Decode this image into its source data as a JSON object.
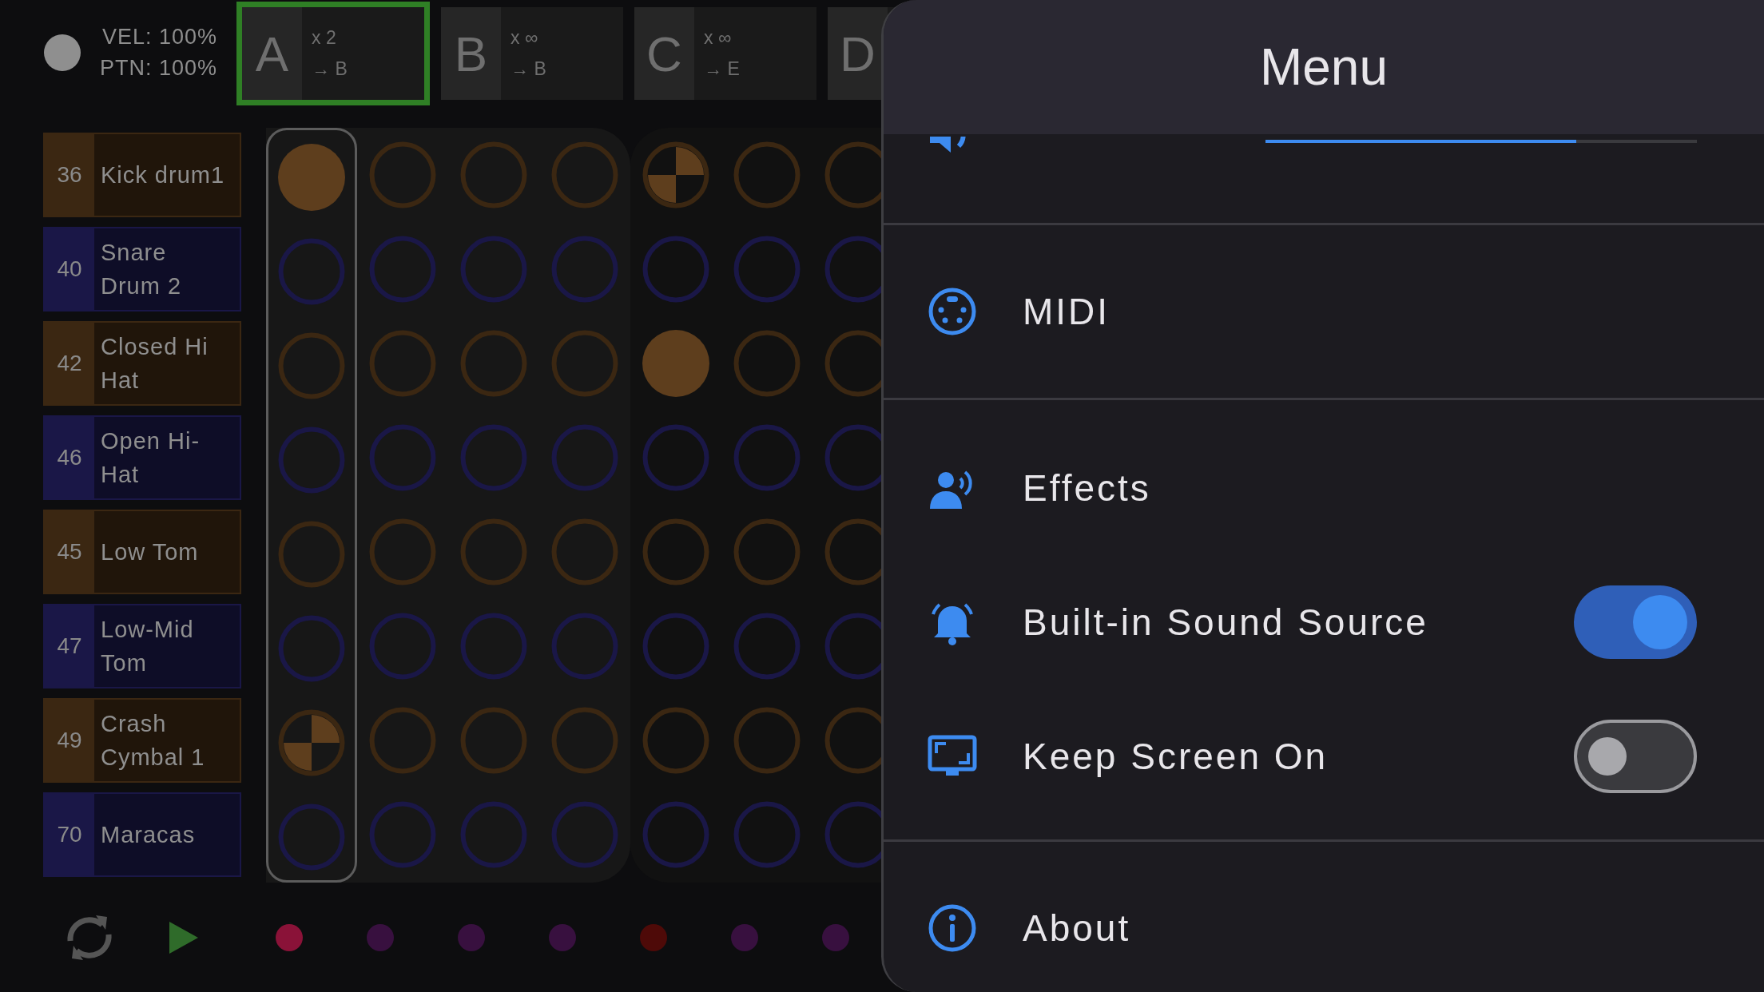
{
  "status": {
    "velocity": "VEL: 100%",
    "pattern": "PTN: 100%"
  },
  "patterns": [
    {
      "letter": "A",
      "repeat": "x 2",
      "next": "→ B",
      "selected": true
    },
    {
      "letter": "B",
      "repeat": "x ∞",
      "next": "→ B",
      "selected": false
    },
    {
      "letter": "C",
      "repeat": "x ∞",
      "next": "→ E",
      "selected": false
    },
    {
      "letter": "D",
      "selected": false
    }
  ],
  "tracks": [
    {
      "note": "36",
      "name": "Kick drum1",
      "color": "#3b2712",
      "steps": [
        {
          "kind": "on"
        },
        {
          "kind": "off"
        },
        {
          "kind": "off"
        },
        {
          "kind": "off"
        },
        {
          "kind": "half"
        },
        {
          "kind": "off"
        },
        {
          "kind": "off"
        }
      ]
    },
    {
      "note": "40",
      "name": "Snare Drum 2",
      "color": "#1a1747",
      "steps": [
        {
          "kind": "off"
        },
        {
          "kind": "off"
        },
        {
          "kind": "off"
        },
        {
          "kind": "off"
        },
        {
          "kind": "off"
        },
        {
          "kind": "off"
        },
        {
          "kind": "off"
        }
      ]
    },
    {
      "note": "42",
      "name": "Closed Hi Hat",
      "color": "#3b2712",
      "steps": [
        {
          "kind": "off"
        },
        {
          "kind": "off"
        },
        {
          "kind": "off"
        },
        {
          "kind": "off"
        },
        {
          "kind": "on"
        },
        {
          "kind": "off"
        },
        {
          "kind": "off"
        }
      ]
    },
    {
      "note": "46",
      "name": "Open Hi-Hat",
      "color": "#1a1747",
      "steps": [
        {
          "kind": "off"
        },
        {
          "kind": "off"
        },
        {
          "kind": "off"
        },
        {
          "kind": "off"
        },
        {
          "kind": "off"
        },
        {
          "kind": "off"
        },
        {
          "kind": "off"
        }
      ]
    },
    {
      "note": "45",
      "name": "Low Tom",
      "color": "#3b2712",
      "steps": [
        {
          "kind": "off"
        },
        {
          "kind": "off"
        },
        {
          "kind": "off"
        },
        {
          "kind": "off"
        },
        {
          "kind": "off"
        },
        {
          "kind": "off"
        },
        {
          "kind": "off"
        }
      ]
    },
    {
      "note": "47",
      "name": "Low-Mid Tom",
      "color": "#1a1747",
      "steps": [
        {
          "kind": "off"
        },
        {
          "kind": "off"
        },
        {
          "kind": "off"
        },
        {
          "kind": "off"
        },
        {
          "kind": "off"
        },
        {
          "kind": "off"
        },
        {
          "kind": "off"
        }
      ]
    },
    {
      "note": "49",
      "name": "Crash Cymbal 1",
      "color": "#3b2712",
      "steps": [
        {
          "kind": "half"
        },
        {
          "kind": "off"
        },
        {
          "kind": "off"
        },
        {
          "kind": "off"
        },
        {
          "kind": "off"
        },
        {
          "kind": "off"
        },
        {
          "kind": "off"
        }
      ]
    },
    {
      "note": "70",
      "name": "Maracas",
      "color": "#1a1747",
      "steps": [
        {
          "kind": "off"
        },
        {
          "kind": "off"
        },
        {
          "kind": "off"
        },
        {
          "kind": "off"
        },
        {
          "kind": "off"
        },
        {
          "kind": "off"
        },
        {
          "kind": "off"
        }
      ]
    }
  ],
  "columns": [
    {
      "selected": true
    },
    {
      "selected": false
    },
    {
      "selected": false
    },
    {
      "selected": false
    },
    {
      "selected": false
    },
    {
      "selected": false
    },
    {
      "selected": false
    }
  ],
  "step_dots": [
    {
      "color": "#8a1238"
    },
    {
      "color": "#38103f"
    },
    {
      "color": "#38103f"
    },
    {
      "color": "#38103f"
    },
    {
      "color": "#4e0a08"
    },
    {
      "color": "#38103f"
    },
    {
      "color": "#38103f"
    }
  ],
  "menu": {
    "title": "Menu",
    "sections": [
      [
        {
          "kind": "slider",
          "level": 0.72
        }
      ],
      [
        {
          "kind": "link",
          "label": "MIDI"
        }
      ],
      [
        {
          "kind": "link",
          "label": "Effects"
        },
        {
          "kind": "toggle",
          "label": "Built-in Sound Source",
          "on": true
        },
        {
          "kind": "toggle",
          "label": "Keep Screen On",
          "on": false
        }
      ],
      [
        {
          "kind": "link",
          "label": "About"
        }
      ]
    ]
  }
}
